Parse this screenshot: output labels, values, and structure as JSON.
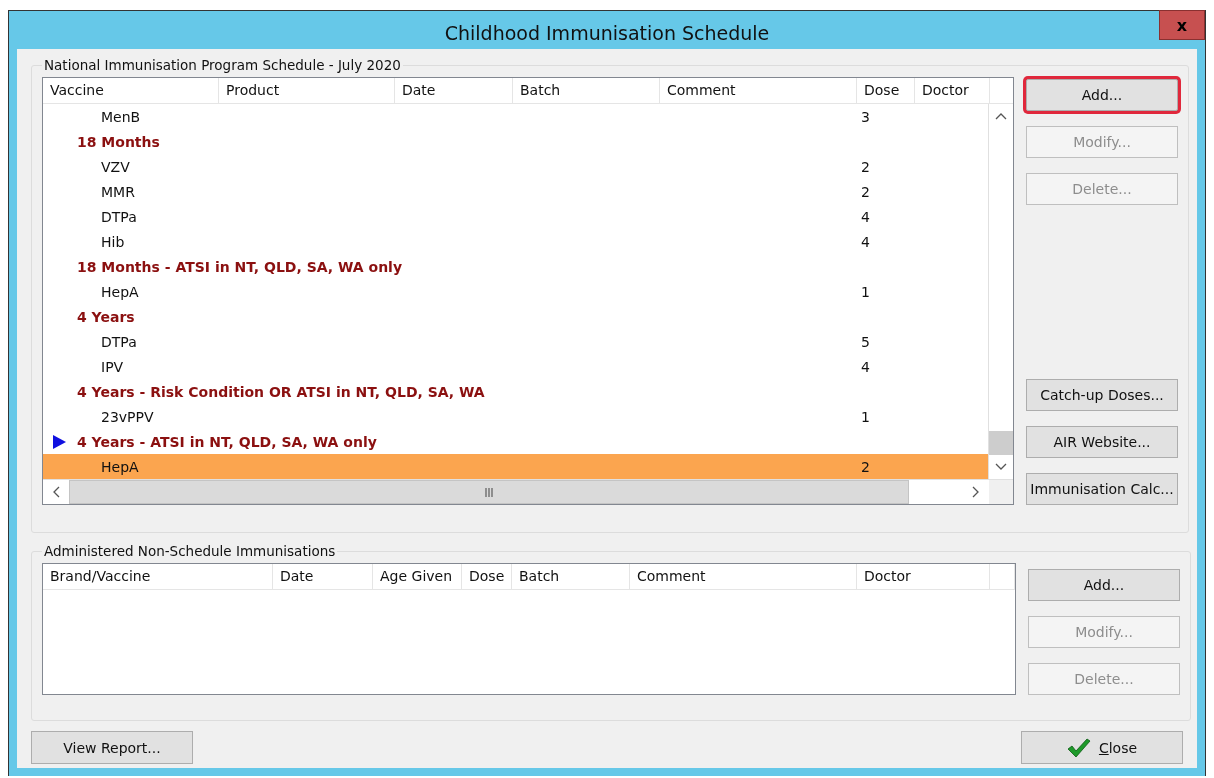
{
  "window": {
    "title": "Childhood Immunisation Schedule",
    "close": "x"
  },
  "schedule": {
    "title": "National Immunisation Program Schedule - July 2020",
    "columns": [
      "Vaccine",
      "Product",
      "Date",
      "Batch",
      "Comment",
      "Dose",
      "Doctor"
    ],
    "rows": [
      {
        "kind": "item",
        "vaccine": "MenB",
        "dose": "3",
        "selected": false,
        "current": false
      },
      {
        "kind": "group",
        "vaccine": "18 Months",
        "selected": false,
        "current": false
      },
      {
        "kind": "item",
        "vaccine": "VZV",
        "dose": "2",
        "selected": false,
        "current": false
      },
      {
        "kind": "item",
        "vaccine": "MMR",
        "dose": "2",
        "selected": false,
        "current": false
      },
      {
        "kind": "item",
        "vaccine": "DTPa",
        "dose": "4",
        "selected": false,
        "current": false
      },
      {
        "kind": "item",
        "vaccine": "Hib",
        "dose": "4",
        "selected": false,
        "current": false
      },
      {
        "kind": "group",
        "vaccine": "18 Months - ATSI in NT, QLD, SA, WA only",
        "selected": false,
        "current": false
      },
      {
        "kind": "item",
        "vaccine": "HepA",
        "dose": "1",
        "selected": false,
        "current": false
      },
      {
        "kind": "group",
        "vaccine": "4 Years",
        "selected": false,
        "current": false
      },
      {
        "kind": "item",
        "vaccine": "DTPa",
        "dose": "5",
        "selected": false,
        "current": false
      },
      {
        "kind": "item",
        "vaccine": "IPV",
        "dose": "4",
        "selected": false,
        "current": false
      },
      {
        "kind": "group",
        "vaccine": "4 Years - Risk Condition OR ATSI in NT, QLD, SA, WA",
        "selected": false,
        "current": false
      },
      {
        "kind": "item",
        "vaccine": "23vPPV",
        "dose": "1",
        "selected": false,
        "current": false
      },
      {
        "kind": "group",
        "vaccine": "4 Years - ATSI in NT, QLD, SA, WA only",
        "selected": false,
        "current": true
      },
      {
        "kind": "item",
        "vaccine": "HepA",
        "dose": "2",
        "selected": true,
        "current": false
      }
    ],
    "buttons_top": [
      {
        "label": "Add...",
        "disabled": false,
        "highlighted": true
      },
      {
        "label": "Modify...",
        "disabled": true,
        "highlighted": false
      },
      {
        "label": "Delete...",
        "disabled": true,
        "highlighted": false
      }
    ],
    "buttons_bottom": [
      {
        "label": "Catch-up Doses...",
        "disabled": false,
        "highlighted": false
      },
      {
        "label": "AIR Website...",
        "disabled": false,
        "highlighted": false
      },
      {
        "label": "Immunisation Calc...",
        "disabled": false,
        "highlighted": false
      }
    ]
  },
  "non_schedule": {
    "title": "Administered Non-Schedule Immunisations",
    "columns": [
      "Brand/Vaccine",
      "Date",
      "Age Given",
      "Dose",
      "Batch",
      "Comment",
      "Doctor"
    ],
    "buttons": [
      {
        "label": "Add...",
        "disabled": false
      },
      {
        "label": "Modify...",
        "disabled": true
      },
      {
        "label": "Delete...",
        "disabled": true
      }
    ]
  },
  "footer": {
    "view_report": "View Report...",
    "close": "Close"
  }
}
